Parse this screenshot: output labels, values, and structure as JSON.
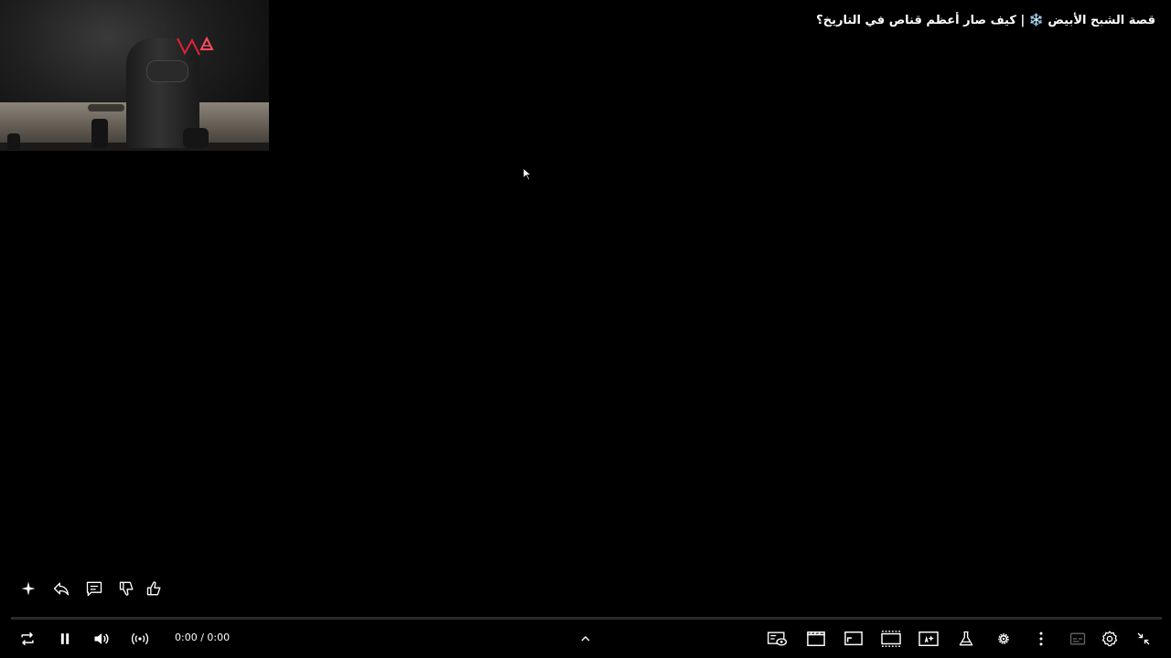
{
  "video": {
    "title": "قصة الشبح الأبيض ❄️ | كيف صار أعظم قناص في التاريخ؟",
    "time_display": "0:00 / 0:00",
    "progress": 0
  },
  "actions": [
    {
      "name": "sparkle-button",
      "icon": "sparkle-icon"
    },
    {
      "name": "share-button",
      "icon": "share-icon"
    },
    {
      "name": "comments-button",
      "icon": "comment-icon"
    },
    {
      "name": "dislike-button",
      "icon": "thumbs-down-icon"
    },
    {
      "name": "like-button",
      "icon": "thumbs-up-icon"
    }
  ],
  "controls": {
    "left": [
      "loop-icon",
      "pause-icon",
      "volume-icon",
      "live-broadcast-icon"
    ],
    "center": [
      "chevron-up-icon"
    ],
    "right": [
      "watch-queue-icon",
      "clapperboard-icon",
      "miniplayer-icon",
      "theater-mode-icon",
      "ambient-mode-icon",
      "lab-flask-icon",
      "extension-gear-icon",
      "more-vert-icon",
      "subtitles-icon",
      "settings-gear-icon",
      "exit-fullscreen-icon"
    ]
  },
  "colors": {
    "background": "#000000",
    "text": "#ffffff",
    "progress_track": "#2b2b2b",
    "neon_accent": "#e0203a"
  }
}
